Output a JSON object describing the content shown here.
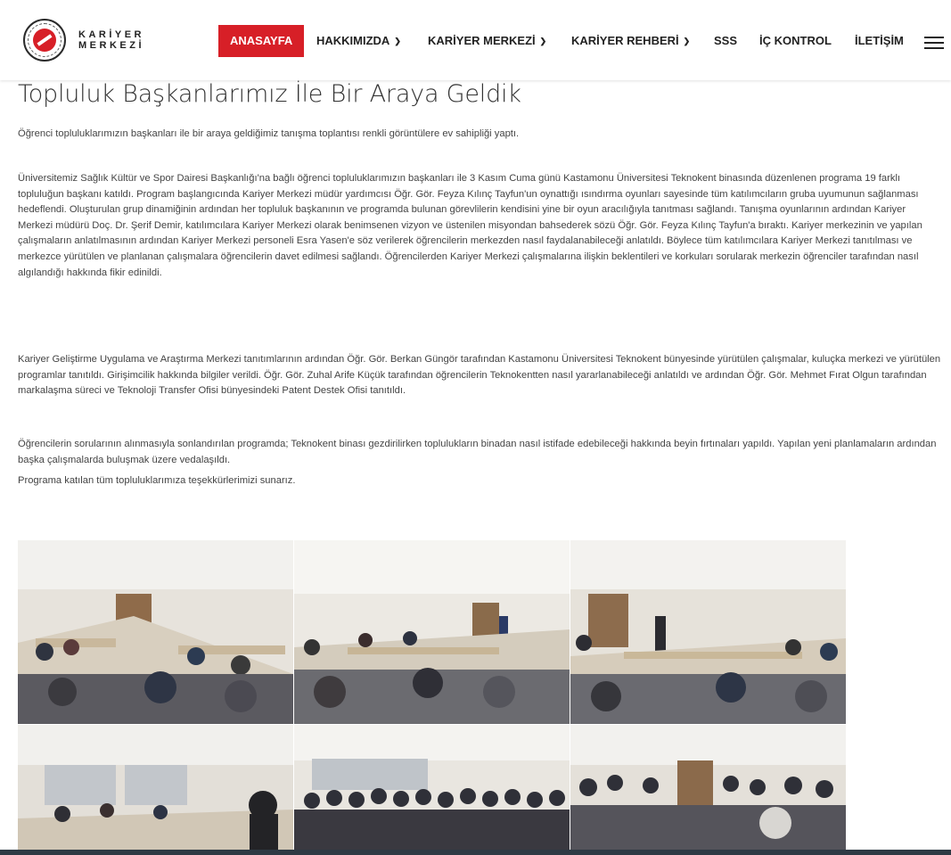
{
  "brand": {
    "line1": "KARİYER",
    "line2": "MERKEZİ"
  },
  "nav": {
    "items": [
      {
        "label": "ANASAYFA",
        "dropdown": false,
        "active": true
      },
      {
        "label": "HAKKIMIZDA",
        "dropdown": true,
        "active": false
      },
      {
        "label": "KARİYER MERKEZİ",
        "dropdown": true,
        "active": false
      },
      {
        "label": "KARİYER REHBERİ",
        "dropdown": true,
        "active": false
      },
      {
        "label": "SSS",
        "dropdown": false,
        "active": false
      },
      {
        "label": "İÇ KONTROL",
        "dropdown": false,
        "active": false
      },
      {
        "label": "İLETİŞİM",
        "dropdown": false,
        "active": false
      }
    ],
    "menu_icon": "hamburger-icon",
    "dropdown_icon": "chevron-down-icon"
  },
  "article": {
    "title": "Topluluk Başkanlarımız İle Bir Araya Geldik",
    "paragraphs": [
      "Öğrenci topluluklarımızın başkanları ile bir araya geldiğimiz tanışma toplantısı renkli görüntülere ev sahipliği yaptı.",
      "Üniversitemiz Sağlık Kültür ve Spor Dairesi Başkanlığı'na bağlı öğrenci topluluklarımızın başkanları ile 3 Kasım Cuma günü Kastamonu Üniversitesi Teknokent binasında düzenlenen programa 19 farklı topluluğun başkanı katıldı. Program başlangıcında Kariyer Merkezi müdür yardımcısı Öğr. Gör. Feyza Kılınç Tayfun'un oynattığı ısındırma oyunları sayesinde tüm katılımcıların gruba uyumunun sağlanması hedeflendi. Oluşturulan grup dinamiğinin ardından her topluluk başkanının ve programda bulunan görevlilerin kendisini yine bir oyun aracılığıyla tanıtması sağlandı. Tanışma oyunlarının ardından Kariyer Merkezi müdürü Doç. Dr. Şerif Demir, katılımcılara Kariyer Merkezi olarak benimsenen vizyon ve üstenilen misyondan bahsederek sözü Öğr. Gör. Feyza Kılınç Tayfun'a bıraktı. Kariyer merkezinin ve yapılan çalışmaların anlatılmasının ardından Kariyer Merkezi personeli Esra Yasen'e söz verilerek öğrencilerin merkezden nasıl faydalanabileceği anlatıldı. Böylece tüm katılımcılara Kariyer Merkezi tanıtılması ve merkezce yürütülen ve planlanan çalışmalara öğrencilerin davet edilmesi sağlandı. Öğrencilerden Kariyer Merkezi çalışmalarına ilişkin beklentileri ve korkuları sorularak merkezin öğrenciler tarafından nasıl algılandığı hakkında fikir edinildi.",
      "Kariyer Geliştirme Uygulama ve Araştırma Merkezi tanıtımlarının ardından Öğr. Gör. Berkan Güngör tarafından Kastamonu Üniversitesi Teknokent bünyesinde yürütülen çalışmalar, kuluçka merkezi ve yürütülen programlar tanıtıldı. Girişimcilik hakkında bilgiler verildi. Öğr. Gör. Zuhal Arife Küçük tarafından öğrencilerin Teknokentten nasıl yararlanabileceği anlatıldı ve ardından Öğr. Gör. Mehmet Fırat Olgun tarafından markalaşma süreci ve Teknoloji Transfer Ofisi bünyesindeki Patent Destek Ofisi tanıtıldı.",
      "Öğrencilerin sorularının alınmasıyla sonlandırılan programda; Teknokent binası gezdirilirken toplulukların binadan nasıl istifade edebileceği hakkında beyin fırtınaları yapıldı. Yapılan yeni planlamaların ardından başka çalışmalarda buluşmak üzere vedalaşıldı.",
      "Programa katılan tüm topluluklarımıza teşekkürlerimizi sunarız."
    ]
  },
  "gallery": {
    "photos": [
      {
        "alt": "meeting-room-photo-1"
      },
      {
        "alt": "meeting-room-photo-2"
      },
      {
        "alt": "meeting-room-photo-3"
      },
      {
        "alt": "meeting-room-photo-4"
      },
      {
        "alt": "group-photo-5"
      },
      {
        "alt": "group-photo-6"
      }
    ]
  },
  "colors": {
    "accent": "#d71f27",
    "text": "#444444",
    "footer": "#2e3a44"
  }
}
